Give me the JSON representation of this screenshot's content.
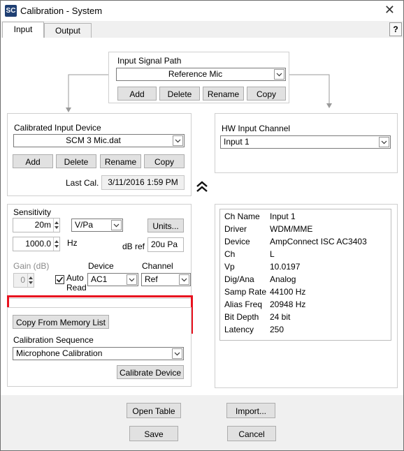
{
  "window": {
    "icon_text": "SC",
    "title": "Calibration  - System",
    "close": "✕",
    "help": "?"
  },
  "tabs": [
    {
      "label": "Input"
    },
    {
      "label": "Output"
    }
  ],
  "input_signal_path": {
    "title": "Input Signal Path",
    "selected": "Reference Mic",
    "buttons": {
      "add": "Add",
      "delete": "Delete",
      "rename": "Rename",
      "copy": "Copy"
    }
  },
  "calibrated_device": {
    "title": "Calibrated Input Device",
    "selected": "SCM 3 Mic.dat",
    "buttons": {
      "add": "Add",
      "delete": "Delete",
      "rename": "Rename",
      "copy": "Copy"
    },
    "last_cal_label": "Last Cal.",
    "last_cal_value": "3/11/2016 1:59 PM"
  },
  "hw_input_channel": {
    "title": "HW Input Channel",
    "selected": "Input 1"
  },
  "sensitivity": {
    "title": "Sensitivity",
    "value": "20m",
    "unit": "V/Pa",
    "units_button": "Units...",
    "hz_value": "1000.0",
    "hz_label": "Hz",
    "dbref_label": "dB ref",
    "dbref_value": "20u Pa",
    "gain_label": "Gain (dB)",
    "gain_value": "0",
    "auto_read_line1": "Auto",
    "auto_read_line2": "Read",
    "auto_read_checked": true,
    "device_label": "Device",
    "device_value": "AC1",
    "channel_label": "Channel",
    "channel_value": "Ref"
  },
  "calibration": {
    "copy_memory_button": "Copy From Memory List",
    "sequence_label": "Calibration Sequence",
    "sequence_value": "Microphone Calibration",
    "calibrate_button": "Calibrate Device"
  },
  "info": [
    {
      "key": "Ch Name",
      "value": "Input 1"
    },
    {
      "key": "Driver",
      "value": "WDM/MME"
    },
    {
      "key": "Device",
      "value": "AmpConnect ISC AC3403"
    },
    {
      "key": "Ch",
      "value": "L"
    },
    {
      "key": "Vp",
      "value": "10.0197"
    },
    {
      "key": "Dig/Ana",
      "value": "Analog"
    },
    {
      "key": "Samp Rate",
      "value": "44100 Hz"
    },
    {
      "key": "Alias Freq",
      "value": "20948 Hz"
    },
    {
      "key": "Bit Depth",
      "value": "24 bit"
    },
    {
      "key": "Latency",
      "value": "250"
    }
  ],
  "bottom": {
    "open_table": "Open Table",
    "import": "Import...",
    "save": "Save",
    "cancel": "Cancel"
  },
  "colors": {
    "highlight": "#e8121f",
    "icon_bg": "#1f3f73"
  },
  "icons": {
    "collapse": "double-chevron-up-icon"
  }
}
